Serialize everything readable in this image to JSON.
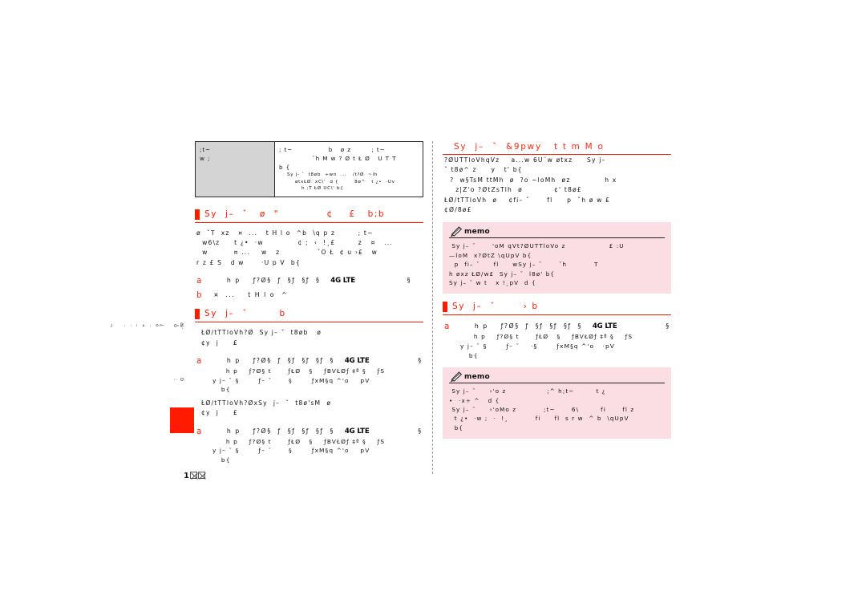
{
  "page": {
    "number_prefix": "1",
    "number_glyph_count": 2,
    "accent_color": "#ff1a00",
    "memo_bg_color": "#fbdde4",
    "table_head_bg": "#d4d4d4"
  },
  "spec_table": {
    "head_cell": [
      ";t~",
      "w ;"
    ],
    "body_cell": [
      "; t~              b   ø z        ; t~",
      "      ˇh M w ? Ø t Ł Ø   U T T",
      "b {"
    ],
    "body_cell_small": [
      "Sy j- ˇ  t8øb  ÷w¤  ...   /t?Ø  ~lh",
      "øtxŁØ  xC\\'  d {        8ø^   t ¿•  ·Uv",
      "h ;T ŁØ UC\\' b{"
    ]
  },
  "left_column": {
    "section_1": {
      "header": "Sy  j–  ˇ   ø  \"            ¢    £   b;b",
      "paragraph": [
        "ø  ˇT  xz   ¤  ...   t H l o  ^b  \\q p z        ; t~",
        "  w6\\z     t ¿•  ·w            ¢ ;  ‹  !¸£        z   ¤   ...",
        "  w         ¤ ...    w   z             ˇO Ł  ¢ u ›£   w",
        "r z £ S   d w      ·U p V  b{"
      ],
      "steps": [
        {
          "num": "a",
          "main_pre": "     h p    ƒ?Ø§  ƒ  §ƒ  §ƒ  §   ",
          "badge": "4G LTE",
          "main_post": "                §",
          "sub": []
        },
        {
          "num": "b",
          "main_pre": " ¤  ...    t H l o  ^",
          "badge": "",
          "main_post": "",
          "sub": []
        }
      ]
    },
    "section_2": {
      "header": "Sy  j–  ˇ        b",
      "paragraph_1": [
        "ŁØ/tTTloVh?Ø  Sy j– ˇ  t8øb   ø",
        "¢y  j     £"
      ],
      "step_1": {
        "num": "a",
        "main_pre": "     h p    ƒ?Ø§  ƒ  §ƒ  §ƒ  §ƒ  §   ",
        "badge": "4G LTE",
        "main_post": "               §",
        "sub": [
          "  h p    ƒ?Ø§ t      ƒŁØ   §    ƒBVŁØƒ ‡ª §    ƒS",
          "y j– ˇ §       ƒ– ˇ      §       ƒxM§q ^'o    pV",
          "  b{"
        ]
      },
      "paragraph_2": [
        "ŁØ/tTTloVh?ØxSy  j–  ˇ  t8ø'sM  ø",
        "¢y  j     £"
      ],
      "step_2": {
        "num": "a",
        "main_pre": "     h p    ƒ?Ø§  ƒ  §ƒ  §ƒ  §ƒ  §   ",
        "badge": "4G LTE",
        "main_post": "               §",
        "sub": [
          "  h p    ƒ?Ø§ t      ƒŁØ   §    ƒBVŁØƒ ‡ª §    ƒS",
          "y j– ˇ §       ƒ– ˇ      §       ƒxM§q ^'o    pV",
          "  b{"
        ]
      }
    }
  },
  "right_column": {
    "section_1": {
      "header": "Sy  j–  ˇ  &9pwy   t t m M o",
      "paragraph": [
        "?ØUTTloVhqVz    a...w 6U¨w øtxz     Sy j–",
        "ˇ t8ø^ z     y   t' b{",
        "  ?  w§TsM ttMh  ø  ?o ~loMh  øz            h x",
        "    z|Z'o ?ØtZsTlh  ø           ¢' t8ø£",
        "ŁØ/tTTloVh  ø    ¢fi– ˇ      fl     p  ˇh ø w £",
        "¢Ø/8ø£"
      ],
      "memo": {
        "label": "memo",
        "lines": [
          " Sy j– ˇ      'oM qVt?ØUTTloVo z                £ :U",
          "—loM  x?ØtZ \\qUpV b{",
          "  p  fi– ˇ     fl     wSy j– ˇ      ˇh          T",
          "h øxz ŁØ/w£  Sy j– ˇ  l8ø' b{",
          "Sy j– ˇ w t   x !¸pV  d {"
        ]
      }
    },
    "section_2": {
      "header": "Sy  j–  ˇ       › b",
      "step": {
        "num": "a",
        "main_pre": "     h p    ƒ?Ø§  ƒ  §ƒ  §ƒ  §ƒ  §   ",
        "badge": "4G LTE",
        "main_post": "               §",
        "sub": [
          "  h p    ƒ?Ø§ t      ƒŁØ   §    ƒBVŁØƒ ‡ª §    ƒS",
          "y j– ˇ §       ƒ– ˇ    ·§       ƒxM§q ^'o   ·pV",
          "  b{"
        ]
      },
      "memo": {
        "label": "memo",
        "lines": [
          " Sy j– ˇ     ›'o z               ;^ h;t~        t ¿",
          "•  ·x÷ ^   d {",
          " Sy j– ˇ     ›'oMo z          ;t~      6\\        fi      fl z",
          "  t ¿•  ·w ;  ·  !¸          fi     fl  s r w  ^ b  \\qUpV",
          "  b{"
        ]
      }
    }
  },
  "side_tab": {
    "vertical_text_1": "æ·\nȭ\n\n¿\nº\n·\n«\n–\n·\n·\n\n¬",
    "vertical_text_2": "b\n:"
  }
}
